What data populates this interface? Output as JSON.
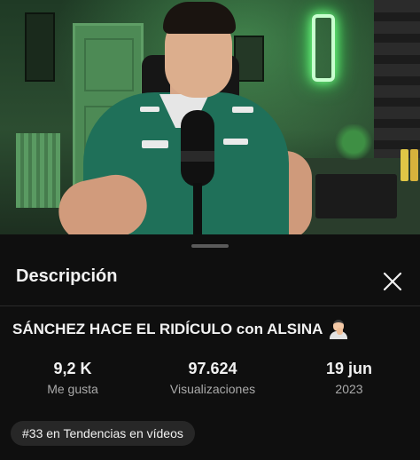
{
  "sheet": {
    "title": "Descripción",
    "close_icon": "close-icon"
  },
  "video": {
    "title": "SÁNCHEZ HACE EL RIDÍCULO con ALSINA",
    "title_emoji": "man-shrugging-emoji",
    "stats": {
      "likes": {
        "value": "9,2 K",
        "label": "Me gusta"
      },
      "views": {
        "value": "97.624",
        "label": "Visualizaciones"
      },
      "date": {
        "value": "19 jun",
        "label": "2023"
      }
    },
    "trending_chip": "#33 en Tendencias en vídeos"
  },
  "colors": {
    "background": "#0f0f0f",
    "chip_bg": "#272727",
    "secondary_text": "#aaaaaa",
    "video_tint": "#2c4d31"
  }
}
